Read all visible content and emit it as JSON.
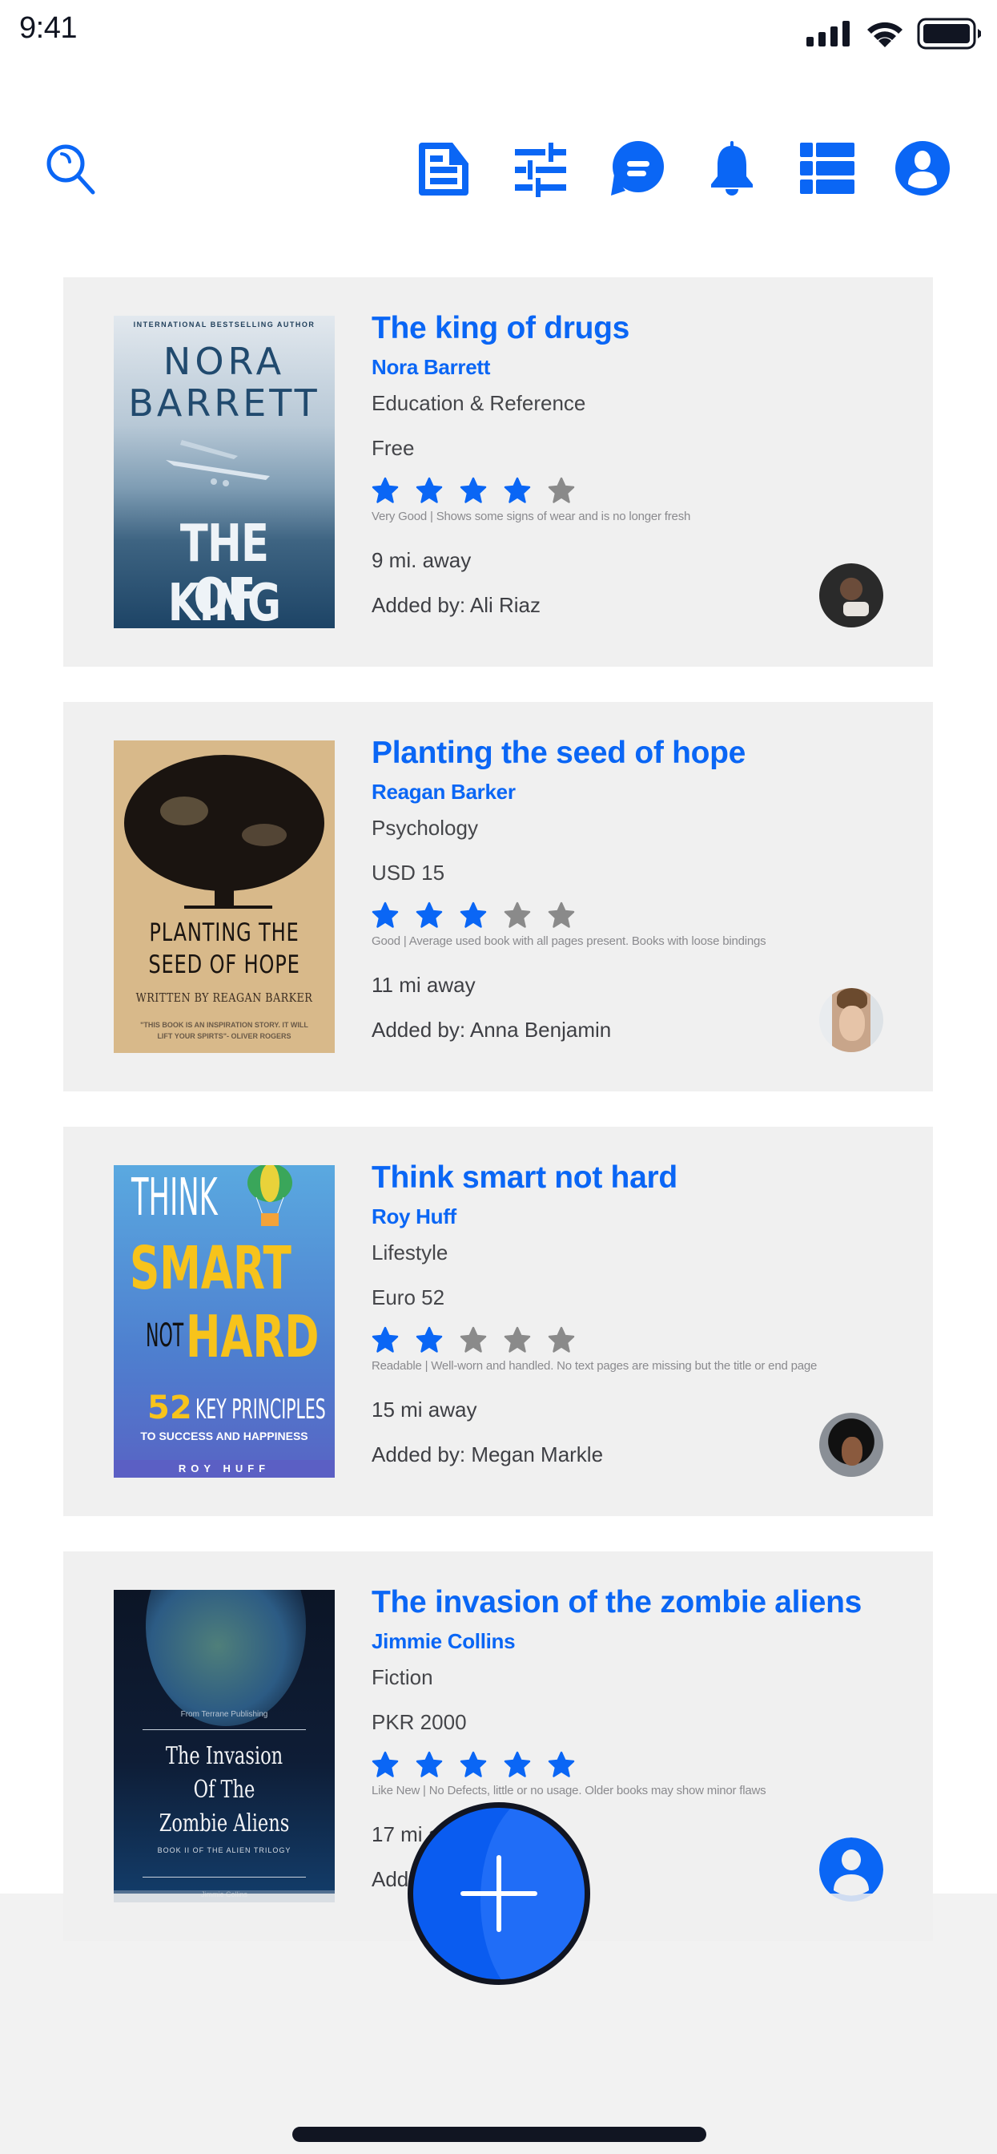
{
  "status_bar": {
    "time": "9:41",
    "icons": [
      "cellular-signal-icon",
      "wifi-icon",
      "battery-icon"
    ]
  },
  "toolbar": {
    "left_icons": [
      "search-icon"
    ],
    "right_icons": [
      "document-icon",
      "filter-sliders-icon",
      "chat-icon",
      "bell-icon",
      "list-view-icon",
      "profile-icon"
    ]
  },
  "colors": {
    "accent": "#0a66f5",
    "star_filled": "#0a66f5",
    "star_empty": "#8a8a8a",
    "card_background": "#f0f0f0"
  },
  "books": [
    {
      "title": "The king of drugs",
      "author": "Nora Barrett",
      "category": "Education & Reference",
      "price": "Free",
      "rating": 4,
      "rating_max": 5,
      "condition": "Very Good | Shows some signs of wear and is no longer fresh",
      "distance": "9 mi. away",
      "added_by": "Added by: Ali Riaz",
      "cover": {
        "top_line": "INTERNATIONAL BESTSELLING AUTHOR",
        "author_line1": "NORA",
        "author_line2": "BARRETT",
        "title_line1": "THE KING",
        "title_line2": "OF DRUGS"
      },
      "avatar": "user-photo"
    },
    {
      "title": "Planting the seed of hope",
      "author": "Reagan Barker",
      "category": "Psychology",
      "price": "USD 15",
      "rating": 3,
      "rating_max": 5,
      "condition": "Good | Average used book with all pages present. Books with loose bindings",
      "distance": "11 mi away",
      "added_by": "Added by: Anna Benjamin",
      "cover": {
        "title_line1": "PLANTING THE",
        "title_line2": "SEED OF HOPE",
        "byline": "WRITTEN BY REAGAN BARKER",
        "quote_line1": "\"THIS BOOK IS AN INSPIRATION STORY. IT WILL",
        "quote_line2": "LIFT YOUR SPIRTS\"- OLIVER ROGERS"
      },
      "avatar": "user-photo"
    },
    {
      "title": "Think smart not hard",
      "author": "Roy Huff",
      "category": "Lifestyle",
      "price": "Euro 52",
      "rating": 2,
      "rating_max": 5,
      "condition": "Readable | Well-worn and handled. No text pages are missing but the title or end page",
      "distance": "15 mi away",
      "added_by": "Added by: Megan Markle",
      "cover": {
        "line1": "THINK",
        "line2": "SMART",
        "line3a": "NOT",
        "line3b": "HARD",
        "sub1a": "52",
        "sub1b": "KEY PRINCIPLES",
        "sub2": "TO SUCCESS AND HAPPINESS",
        "author": "ROY HUFF"
      },
      "avatar": "user-photo"
    },
    {
      "title": "The invasion of the zombie aliens",
      "author": "Jimmie Collins",
      "category": "Fiction",
      "price": "PKR 2000",
      "rating": 5,
      "rating_max": 5,
      "condition": "Like New | No Defects, little or no usage. Older books may show minor flaws",
      "distance": "17 mi away",
      "added_by": "Added by:",
      "cover": {
        "publisher": "From Terrane Publishing",
        "title_line1": "The Invasion",
        "title_line2": "Of The",
        "title_line3": "Zombie Aliens",
        "series": "BOOK II OF THE ALIEN TRILOGY",
        "author": "Jimmie Collins"
      },
      "avatar": "default-profile-icon"
    }
  ],
  "fab": {
    "icon": "plus-icon",
    "label": "Add book"
  }
}
